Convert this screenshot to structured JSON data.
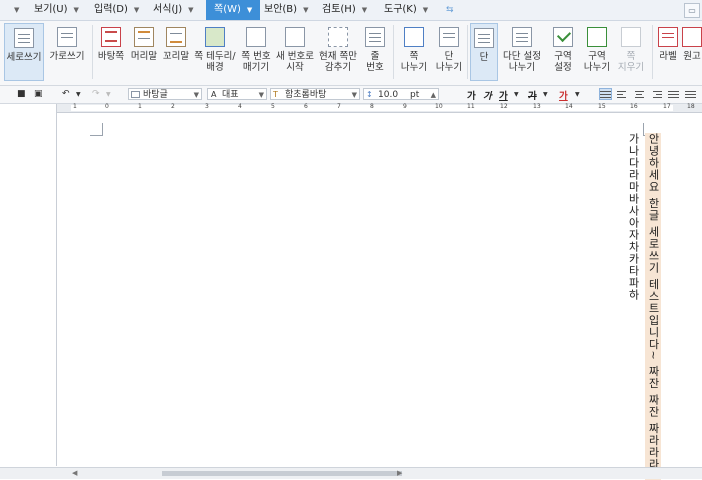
{
  "menu": {
    "items": [
      {
        "label": "보기(U)"
      },
      {
        "label": "입력(D)"
      },
      {
        "label": "서식(J)"
      },
      {
        "label": "쪽(W)"
      },
      {
        "label": "보안(B)"
      },
      {
        "label": "검토(H)"
      },
      {
        "label": "도구(K)"
      }
    ],
    "active_index": 3,
    "accent_color": "#3d8fd8"
  },
  "ribbon": {
    "buttons": [
      {
        "label": "세로쓰기",
        "icon": "vertical-writing-icon",
        "selected": true
      },
      {
        "label": "가로쓰기",
        "icon": "horizontal-writing-icon"
      },
      {
        "label": "바탕쪽",
        "icon": "master-page-icon"
      },
      {
        "label": "머리말",
        "icon": "header-icon"
      },
      {
        "label": "꼬리말",
        "icon": "footer-icon"
      },
      {
        "label": "쪽 테두리/\n배경",
        "icon": "page-border-icon"
      },
      {
        "label": "쪽 번호\n매기기",
        "icon": "page-number-icon"
      },
      {
        "label": "새 번호로\n시작",
        "icon": "new-number-icon"
      },
      {
        "label": "현재 쪽만\n감추기",
        "icon": "hide-icon"
      },
      {
        "label": "줄\n번호",
        "icon": "line-number-icon"
      },
      {
        "label": "쪽\n나누기",
        "icon": "page-break-icon"
      },
      {
        "label": "단\n나누기",
        "icon": "column-break-icon"
      },
      {
        "label": "단",
        "icon": "column-icon",
        "selected": true
      },
      {
        "label": "다단 설정\n나누기",
        "icon": "multi-column-icon"
      },
      {
        "label": "구역\n설정",
        "icon": "section-setting-icon"
      },
      {
        "label": "구역\n나누기",
        "icon": "section-break-icon"
      },
      {
        "label": "쪽\n지우기",
        "icon": "delete-page-icon",
        "disabled": true
      },
      {
        "label": "라벨",
        "icon": "label-icon"
      },
      {
        "label": "원고",
        "icon": "manuscript-icon"
      }
    ]
  },
  "format": {
    "style": "바탕글",
    "font_lang": "대표",
    "font_name": "함초롬바탕",
    "font_size": "10.0",
    "size_unit": "pt",
    "bold": "가",
    "italic": "가",
    "underline": "가",
    "strike": "가",
    "color_text": "가"
  },
  "ruler": {
    "numbers": [
      "1",
      "0",
      "1",
      "2",
      "3",
      "4",
      "5",
      "6",
      "7",
      "8",
      "9",
      "10",
      "11",
      "12",
      "13",
      "14",
      "15",
      "16",
      "17",
      "18"
    ]
  },
  "document": {
    "lines": [
      "안녕하세요 한글 세로쓰기 테스트입니다~ 짜잔 짜잔 짜라라라~",
      "가나다라마바사아자차카타파하"
    ],
    "highlight_color": "#f7e5d4"
  }
}
